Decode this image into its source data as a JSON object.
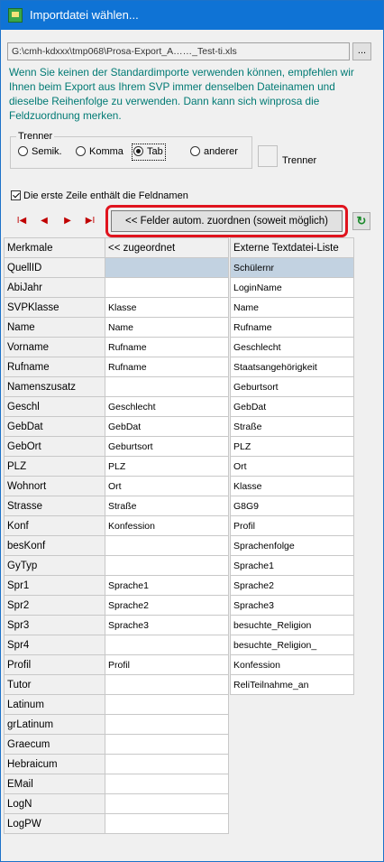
{
  "window": {
    "title": "Importdatei wählen..."
  },
  "file": {
    "path": "G:\\cmh-kdxxx\\tmp068\\Prosa-Export_A……_Test-ti.xls",
    "browse_label": "..."
  },
  "info_text": "Wenn Sie keinen der Standardimporte verwenden können, empfehlen wir Ihnen beim Export aus Ihrem SVP immer denselben Dateinamen und dieselbe Reihenfolge zu verwenden. Dann kann sich winprosa die Feldzuordnung merken.",
  "separator": {
    "legend": "Trenner",
    "options": [
      {
        "label": "Semik.",
        "checked": false
      },
      {
        "label": "Komma",
        "checked": false
      },
      {
        "label": "Tab",
        "checked": true
      },
      {
        "label": "anderer",
        "checked": false
      }
    ],
    "custom_label": "Trenner"
  },
  "header_row_checkbox": {
    "label": "Die erste Zeile enthält die Feldnamen",
    "checked": true
  },
  "nav": {
    "first": "I◀",
    "prev": "◀",
    "next": "▶",
    "last": "▶I"
  },
  "auto_assign_button": "<< Felder autom. zuordnen (soweit möglich)",
  "refresh_icon": "↻",
  "mapping_table": {
    "headers": [
      "Merkmale",
      "<< zugeordnet"
    ],
    "rows": [
      [
        "QuellID",
        ""
      ],
      [
        "AbiJahr",
        ""
      ],
      [
        "SVPKlasse",
        "Klasse"
      ],
      [
        "Name",
        "Name"
      ],
      [
        "Vorname",
        "Rufname"
      ],
      [
        "Rufname",
        "Rufname"
      ],
      [
        "Namenszusatz",
        ""
      ],
      [
        "Geschl",
        "Geschlecht"
      ],
      [
        "GebDat",
        "GebDat"
      ],
      [
        "GebOrt",
        "Geburtsort"
      ],
      [
        "PLZ",
        "PLZ"
      ],
      [
        "Wohnort",
        "Ort"
      ],
      [
        "Strasse",
        "Straße"
      ],
      [
        "Konf",
        "Konfession"
      ],
      [
        "besKonf",
        ""
      ],
      [
        "GyTyp",
        ""
      ],
      [
        "Spr1",
        "Sprache1"
      ],
      [
        "Spr2",
        "Sprache2"
      ],
      [
        "Spr3",
        "Sprache3"
      ],
      [
        "Spr4",
        ""
      ],
      [
        "Profil",
        "Profil"
      ],
      [
        "Tutor",
        ""
      ],
      [
        "Latinum",
        ""
      ],
      [
        "grLatinum",
        ""
      ],
      [
        "Graecum",
        ""
      ],
      [
        "Hebraicum",
        ""
      ],
      [
        "EMail",
        ""
      ],
      [
        "LogN",
        ""
      ],
      [
        "LogPW",
        ""
      ]
    ]
  },
  "external_list": {
    "header": "Externe Textdatei-Liste",
    "items": [
      "Schülernr",
      "LoginName",
      "Name",
      "Rufname",
      "Geschlecht",
      "Staatsangehörigkeit",
      "Geburtsort",
      "GebDat",
      "Straße",
      "PLZ",
      "Ort",
      "Klasse",
      "G8G9",
      "Profil",
      "Sprachenfolge",
      "Sprache1",
      "Sprache2",
      "Sprache3",
      "besuchte_Religion",
      "besuchte_Religion_",
      "Konfession",
      "ReliTeilnahme_an"
    ]
  }
}
